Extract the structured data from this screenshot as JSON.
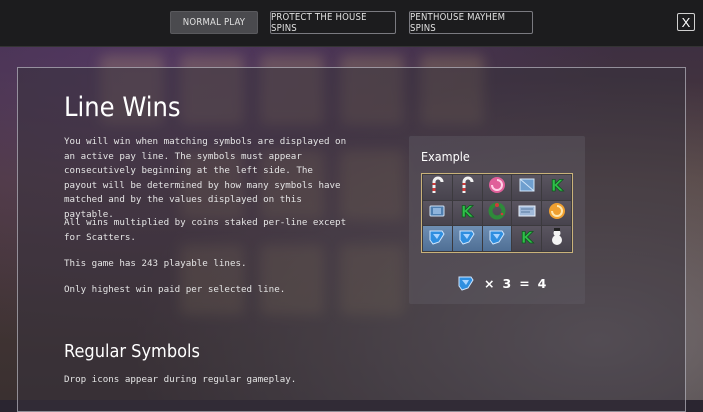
{
  "tabs": [
    {
      "label": "NORMAL PLAY",
      "active": true
    },
    {
      "label": "PROTECT THE HOUSE SPINS",
      "active": false
    },
    {
      "label": "PENTHOUSE MAYHEM SPINS",
      "active": false
    }
  ],
  "close_label": "X",
  "section": {
    "title": "Line Wins",
    "paragraphs": [
      "You will win when matching symbols are displayed on an active pay line. The symbols must appear consecutively beginning at the left side. The payout will be determined by how many symbols have matched and by the values displayed on this paytable.",
      "All wins multiplied by coins staked per-line except for Scatters.",
      "This game has 243 playable lines.",
      "Only highest win paid per selected line."
    ]
  },
  "example": {
    "label": "Example",
    "grid": [
      [
        "candy-cane-icon",
        "candy-cane-icon",
        "pink-swirl-icon",
        "blue-box-icon",
        "green-k-icon"
      ],
      [
        "blue-book-icon",
        "green-k-icon",
        "wreath-icon",
        "blue-paper-icon",
        "orange-swirl-icon"
      ],
      [
        "drop-icon",
        "drop-icon",
        "drop-icon",
        "green-k-icon",
        "snowman-icon"
      ]
    ],
    "highlight_row": 2,
    "highlight_count": 3,
    "result_symbol": "drop-icon",
    "result_times": "×",
    "result_count": "3",
    "result_equals": "=",
    "result_lines": "4"
  },
  "regular": {
    "title": "Regular Symbols",
    "subtitle": "Drop icons appear during regular gameplay."
  },
  "colors": {
    "accent_blue": "#2f8fe0",
    "green_k": "#2fbf4a",
    "pink": "#e0609a"
  }
}
